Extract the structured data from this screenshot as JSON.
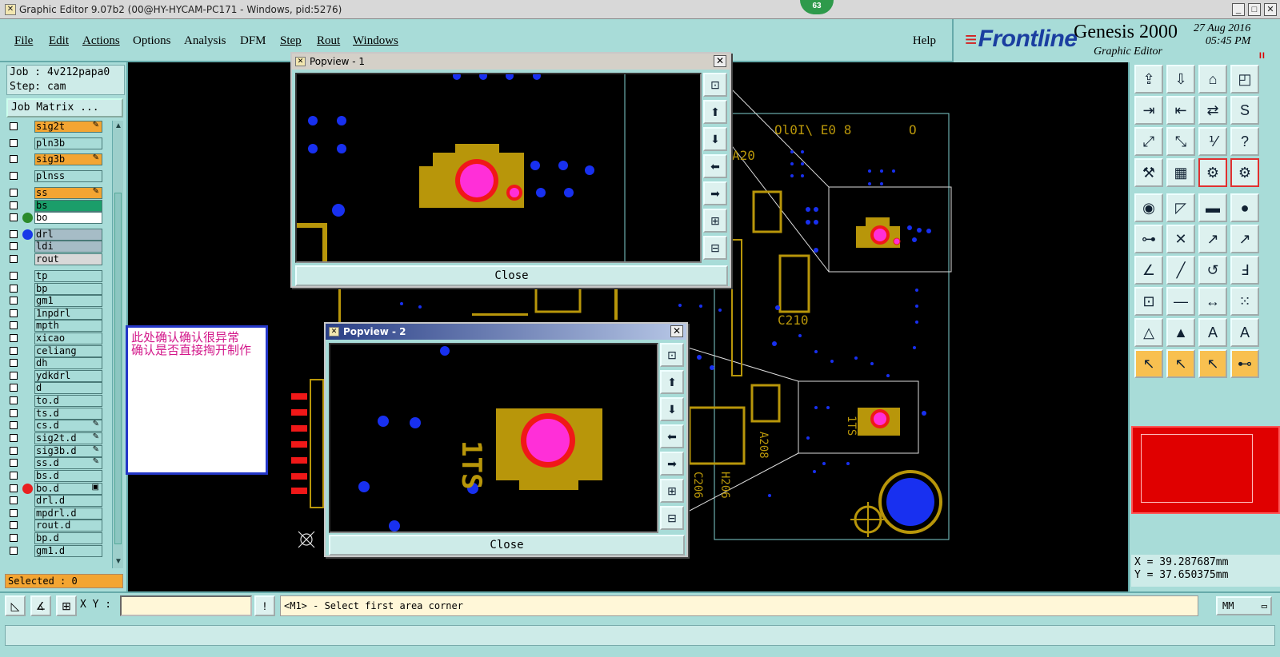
{
  "window": {
    "title": "Graphic Editor 9.07b2 (00@HY-HYCAM-PC171 - Windows, pid:5276)",
    "badge": "63"
  },
  "menu": {
    "items": [
      "File",
      "Edit",
      "Actions",
      "Options",
      "Analysis",
      "DFM",
      "Step",
      "Rout",
      "Windows"
    ],
    "help": "Help"
  },
  "brand": {
    "logo": "Frontline",
    "product": "Genesis 2000",
    "subtitle": "Graphic Editor",
    "date": "27 Aug 2016",
    "time": "05:45 PM",
    "pause": "II"
  },
  "job": {
    "job_line": "Job : 4v212papa0",
    "step_line": "Step: cam",
    "matrix_label": "Job Matrix ...",
    "selected_line": "Selected : 0"
  },
  "layers": [
    {
      "name": "sig2t",
      "bg": "#f3a532",
      "dot": "",
      "flag": "✎"
    },
    {
      "name": "pln3b",
      "bg": "#a8dcd8",
      "dot": "",
      "flag": ""
    },
    {
      "name": "sig3b",
      "bg": "#f3a532",
      "dot": "",
      "flag": "✎"
    },
    {
      "name": "plnss",
      "bg": "#a8dcd8",
      "dot": "",
      "flag": ""
    },
    {
      "name": "ss",
      "bg": "#f3a532",
      "dot": "",
      "flag": "✎"
    },
    {
      "name": "bs",
      "bg": "#1b9e6a",
      "dot": "",
      "flag": ""
    },
    {
      "name": "bo",
      "bg": "#ffffff",
      "dot": "#2b8a2b",
      "flag": ""
    },
    {
      "name": "drl",
      "bg": "#a6bcc6",
      "dot": "#1838e8",
      "flag": ""
    },
    {
      "name": "ldi",
      "bg": "#a6bcc6",
      "dot": "",
      "flag": ""
    },
    {
      "name": "rout",
      "bg": "#d8d8d8",
      "dot": "",
      "flag": ""
    },
    {
      "name": "tp",
      "bg": "#a8dcd8",
      "dot": "",
      "flag": ""
    },
    {
      "name": "bp",
      "bg": "#a8dcd8",
      "dot": "",
      "flag": ""
    },
    {
      "name": "gm1",
      "bg": "#a8dcd8",
      "dot": "",
      "flag": ""
    },
    {
      "name": "1npdrl",
      "bg": "#a8dcd8",
      "dot": "",
      "flag": ""
    },
    {
      "name": "mpth",
      "bg": "#a8dcd8",
      "dot": "",
      "flag": ""
    },
    {
      "name": "xicao",
      "bg": "#a8dcd8",
      "dot": "",
      "flag": ""
    },
    {
      "name": "celiang",
      "bg": "#a8dcd8",
      "dot": "",
      "flag": ""
    },
    {
      "name": "dh",
      "bg": "#a8dcd8",
      "dot": "",
      "flag": ""
    },
    {
      "name": "ydkdrl",
      "bg": "#a8dcd8",
      "dot": "",
      "flag": ""
    },
    {
      "name": "d",
      "bg": "#a8dcd8",
      "dot": "",
      "flag": ""
    },
    {
      "name": "to.d",
      "bg": "#a8dcd8",
      "dot": "",
      "flag": ""
    },
    {
      "name": "ts.d",
      "bg": "#a8dcd8",
      "dot": "",
      "flag": ""
    },
    {
      "name": "cs.d",
      "bg": "#a8dcd8",
      "dot": "",
      "flag": "✎"
    },
    {
      "name": "sig2t.d",
      "bg": "#a8dcd8",
      "dot": "",
      "flag": "✎"
    },
    {
      "name": "sig3b.d",
      "bg": "#a8dcd8",
      "dot": "",
      "flag": "✎"
    },
    {
      "name": "ss.d",
      "bg": "#a8dcd8",
      "dot": "",
      "flag": "✎"
    },
    {
      "name": "bs.d",
      "bg": "#a8dcd8",
      "dot": "",
      "flag": ""
    },
    {
      "name": "bo.d",
      "bg": "#a8dcd8",
      "dot": "#e82020",
      "flag": "▣"
    },
    {
      "name": "drl.d",
      "bg": "#a8dcd8",
      "dot": "",
      "flag": ""
    },
    {
      "name": "mpdrl.d",
      "bg": "#a8dcd8",
      "dot": "",
      "flag": ""
    },
    {
      "name": "rout.d",
      "bg": "#a8dcd8",
      "dot": "",
      "flag": ""
    },
    {
      "name": "bp.d",
      "bg": "#a8dcd8",
      "dot": "",
      "flag": ""
    },
    {
      "name": "gm1.d",
      "bg": "#a8dcd8",
      "dot": "",
      "flag": ""
    }
  ],
  "note": {
    "line1": "此处确认确认很异常",
    "line2": "确认是否直接掏开制作"
  },
  "popups": {
    "p1_title": "Popview - 1",
    "p2_title": "Popview - 2",
    "close_label": "Close"
  },
  "board_text": {
    "top_label": "Ol0I\\ E0 8",
    "top_o": "O",
    "a20": "A20",
    "c210": "C210",
    "a208": "A208",
    "c206": "C206",
    "h206": "H206",
    "m_label": "1TS",
    "sig_label": "1TS"
  },
  "coords": {
    "x": "X = 39.287687mm",
    "y": "Y = 37.650375mm"
  },
  "bottom": {
    "xy_label": "X Y :",
    "message": "<M1> - Select first area corner",
    "unit": "MM"
  },
  "colors": {
    "pad": "#b8960a",
    "via": "#1830f0",
    "drill": "#ff2fd8",
    "ring": "#f01818",
    "outline": "#7fd0d0"
  }
}
